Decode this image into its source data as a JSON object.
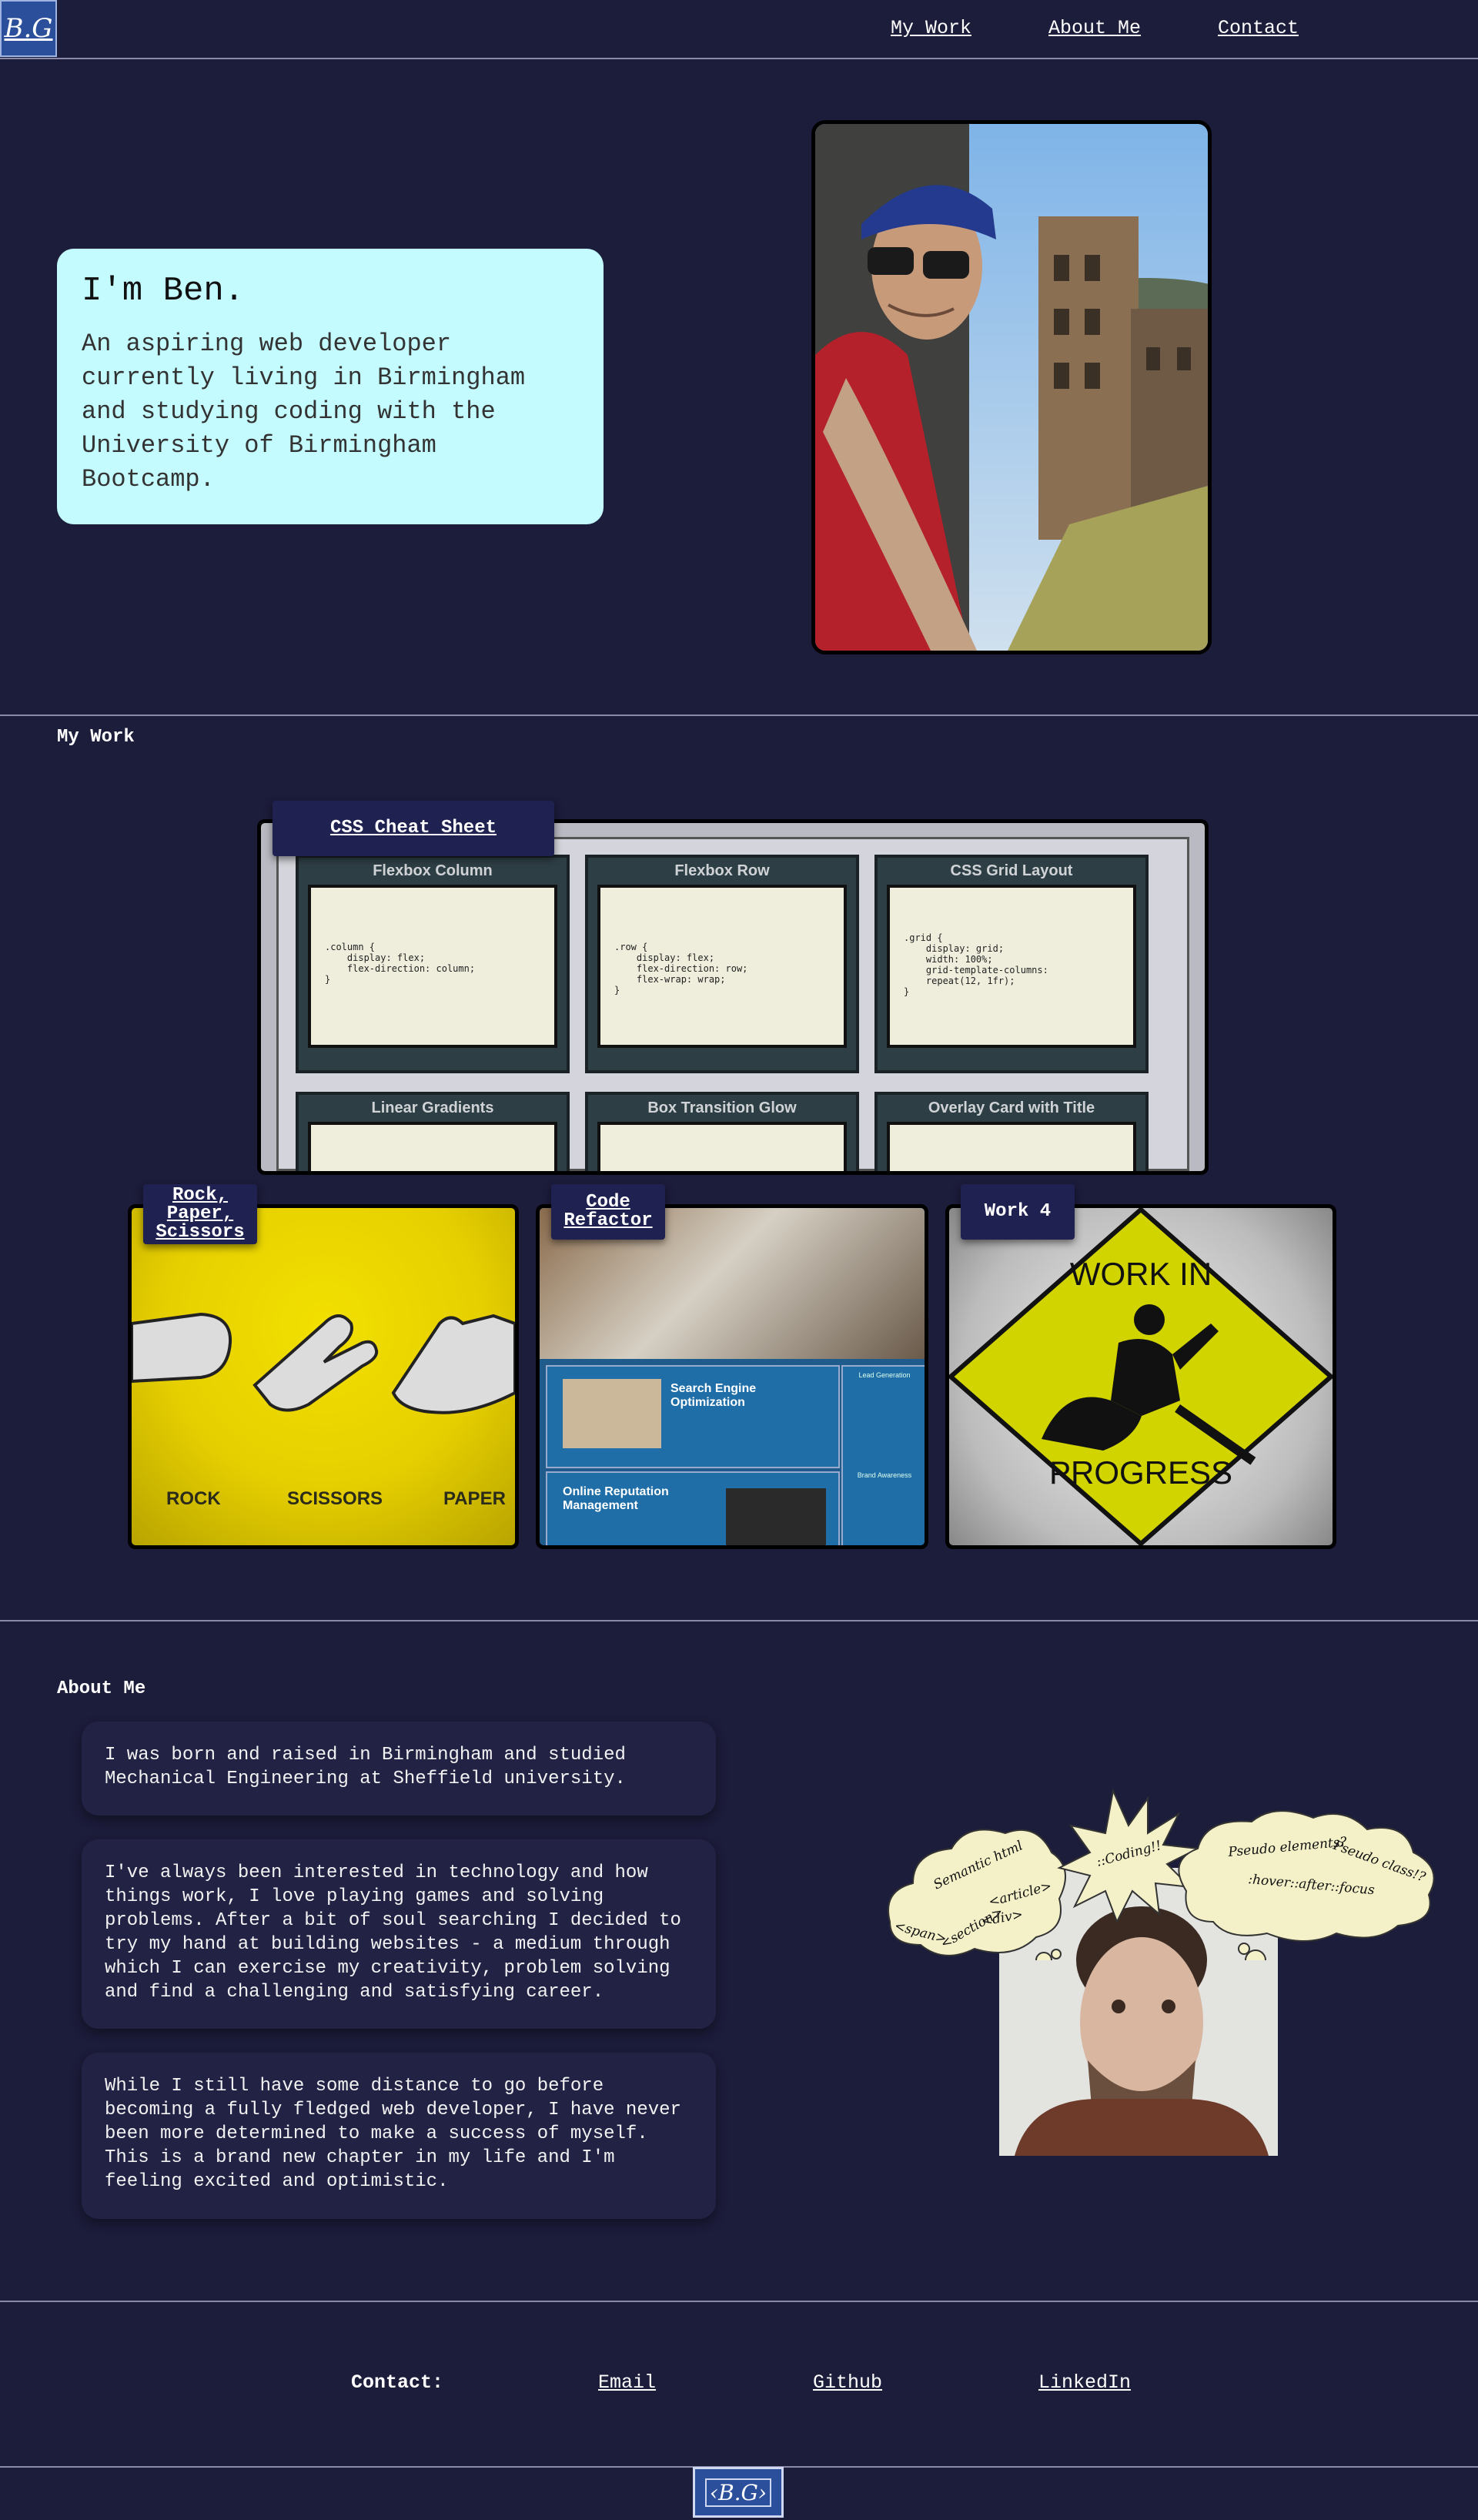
{
  "header": {
    "logo_text": "B.G",
    "nav": [
      "My Work",
      "About Me",
      "Contact"
    ]
  },
  "hero": {
    "title": "I'm Ben.",
    "text": "An aspiring web developer currently living in Birmingham and studying coding with the University of Birmingham Bootcamp."
  },
  "work": {
    "title": "My Work",
    "projects": [
      {
        "label": "CSS Cheat Sheet"
      },
      {
        "label": "Rock, Paper, Scissors"
      },
      {
        "label": "Code Refactor"
      },
      {
        "label": "Work 4"
      }
    ],
    "cheat_sheet_panels": [
      {
        "title": "Flexbox Column",
        "code": ".column {\n    display: flex;\n    flex-direction: column;\n}"
      },
      {
        "title": "Flexbox Row",
        "code": ".row {\n    display: flex;\n    flex-direction: row;\n    flex-wrap: wrap;\n}"
      },
      {
        "title": "CSS Grid Layout",
        "code": ".grid {\n    display: grid;\n    width: 100%;\n    grid-template-columns:\n    repeat(12, 1fr);\n}"
      },
      {
        "title": "Linear Gradients",
        "code": ""
      },
      {
        "title": "Box Transition Glow",
        "code": ""
      },
      {
        "title": "Overlay Card with Title",
        "code": ""
      }
    ],
    "rps_labels": [
      "ROCK",
      "SCISSORS",
      "PAPER"
    ],
    "refactor_sections": [
      "Search Engine Optimization",
      "Online Reputation Management",
      "Lead Generation",
      "Brand Awareness"
    ],
    "wip_lines": [
      "WORK IN",
      "PROGRESS"
    ]
  },
  "about": {
    "title": "About Me",
    "paragraphs": [
      "I was born and raised in Birmingham and studied Mechanical Engineering at Sheffield university.",
      "I've always been interested in technology and how things work, I love playing games and solving problems. After a bit of soul searching I decided to try my hand at building websites - a medium through which I can exercise my creativity, problem solving and find a challenging and satisfying career.",
      "While I still have some distance to go before becoming a fully fledged web developer, I have never been more determined to make a success of myself. This is a brand new chapter in my life and I'm feeling excited and optimistic."
    ],
    "thoughts": {
      "left": [
        "Semantic html",
        "<article>",
        "<div>",
        "<span>",
        "<section>"
      ],
      "middle": "::Coding!!",
      "right": [
        "Pseudo elements?",
        "Pseudo class!?",
        ":hover::after::focus"
      ]
    }
  },
  "contact": {
    "title": "Contact:",
    "links": [
      "Email",
      "Github",
      "LinkedIn"
    ]
  },
  "footer": {
    "logo_text": "B.G"
  },
  "colors": {
    "background": "#1c1c3b",
    "intro_card": "#c4fbff",
    "tag": "#1f2150",
    "logo": "#2b4f9a"
  }
}
